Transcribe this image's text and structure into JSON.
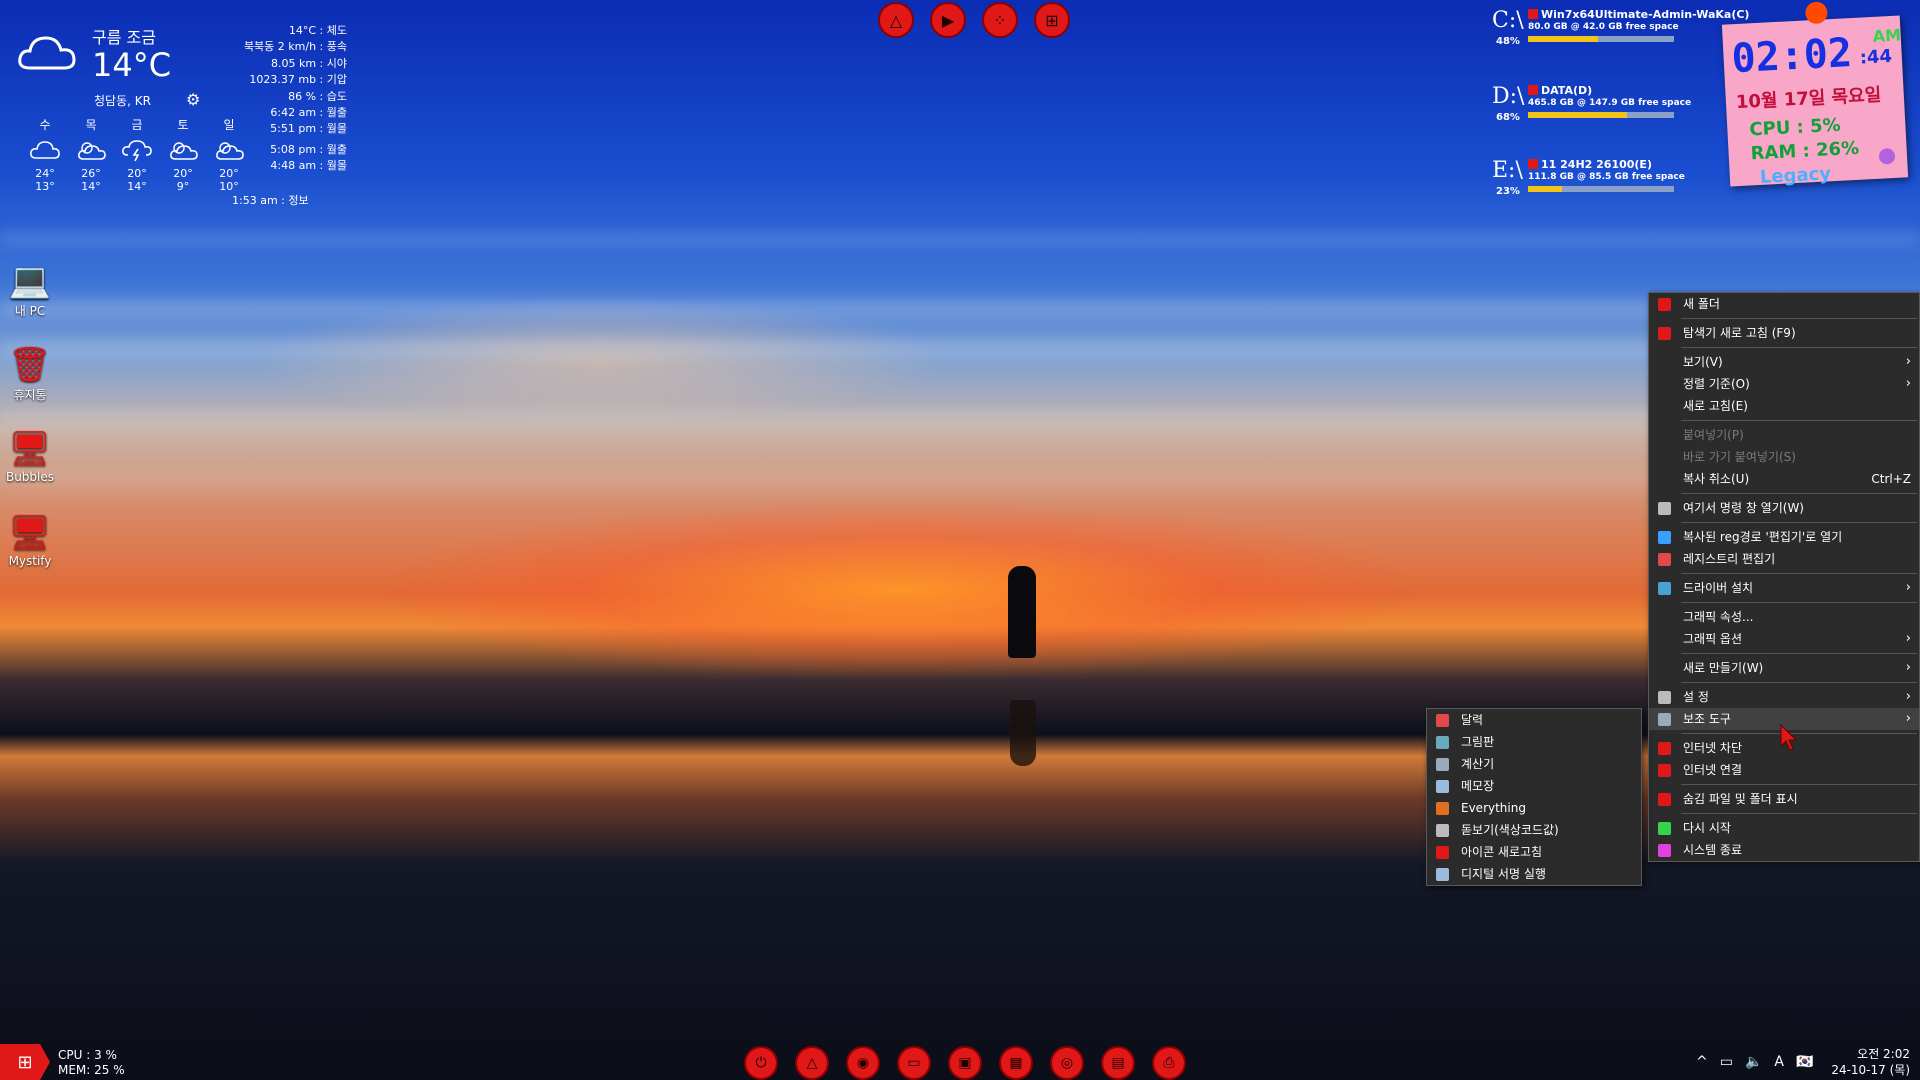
{
  "weather": {
    "condition": "구름 조금",
    "temp": "14°C",
    "location": "청담동, KR",
    "stats": [
      "14°C : 체도",
      "북북동 2 km/h : 풍속",
      "8.05 km : 시야",
      "1023.37 mb : 기압",
      "86 % : 습도",
      "6:42 am : 월출",
      "5:51 pm : 월몰",
      "5:08 pm : 월출",
      "4:48 am : 월몰"
    ],
    "updated": "1:53 am : 정보",
    "forecast": [
      {
        "day": "수",
        "hi": "24°",
        "lo": "13°",
        "icon": "cloud-icon"
      },
      {
        "day": "목",
        "hi": "26°",
        "lo": "14°",
        "icon": "partly-sunny-icon"
      },
      {
        "day": "금",
        "hi": "20°",
        "lo": "14°",
        "icon": "thunder-icon"
      },
      {
        "day": "토",
        "hi": "20°",
        "lo": "9°",
        "icon": "partly-sunny-icon"
      },
      {
        "day": "일",
        "hi": "20°",
        "lo": "10°",
        "icon": "partly-sunny-icon"
      }
    ]
  },
  "desktop_icons": [
    {
      "label": "내 PC",
      "icon": "computer-icon"
    },
    {
      "label": "휴지통",
      "icon": "trash-icon"
    },
    {
      "label": "Bubbles",
      "icon": "monitor-icon"
    },
    {
      "label": "Mystify",
      "icon": "monitor-icon"
    }
  ],
  "top_icons": [
    "triangle-icon",
    "play-icon",
    "dots-icon",
    "windows-icon"
  ],
  "drives": [
    {
      "letter": "C:\\",
      "pct": "48%",
      "name": "Win7x64Ultimate-Admin-WaKa(C)",
      "info": "80.0 GB @    42.0 GB free space",
      "fill": 0.48
    },
    {
      "letter": "D:\\",
      "pct": "68%",
      "name": "DATA(D)",
      "info": "465.8 GB @ 147.9 GB free space",
      "fill": 0.68
    },
    {
      "letter": "E:\\",
      "pct": "23%",
      "name": "11 24H2 26100(E)",
      "info": "111.8 GB @ 85.5 GB free space",
      "fill": 0.23
    }
  ],
  "note": {
    "time": "02:02",
    "seconds": ":44",
    "ampm": "AM",
    "date": "10월 17일 목요일",
    "cpu": "CPU :  5%",
    "ram": "RAM :  26%",
    "legacy": "Legacy"
  },
  "main_menu": {
    "items": [
      {
        "label": "새 폴더",
        "icon": "folder-icon",
        "color": "#e01818"
      },
      {
        "sep": true
      },
      {
        "label": "탐색기 새로 고침 (F9)",
        "icon": "refresh-icon",
        "color": "#e01818"
      },
      {
        "sep": true
      },
      {
        "label": "보기(V)",
        "arrow": true
      },
      {
        "label": "정렬 기준(O)",
        "arrow": true
      },
      {
        "label": "새로 고침(E)"
      },
      {
        "sep": true
      },
      {
        "label": "붙여넣기(P)",
        "disabled": true
      },
      {
        "label": "바로 가기 붙여넣기(S)",
        "disabled": true
      },
      {
        "label": "복사 취소(U)",
        "shortcut": "Ctrl+Z"
      },
      {
        "sep": true
      },
      {
        "label": "여기서 명령 창 열기(W)",
        "icon": "cmd-icon",
        "color": "#bbbbbb"
      },
      {
        "sep": true
      },
      {
        "label": "복사된 reg경로 '편집기'로 열기",
        "icon": "registry-icon",
        "color": "#3aa0ff"
      },
      {
        "label": "레지스트리 편집기",
        "icon": "registry-icon",
        "color": "#e04a4a"
      },
      {
        "sep": true
      },
      {
        "label": "드라이버 설치",
        "icon": "driver-icon",
        "color": "#4aa0d0",
        "arrow": true
      },
      {
        "sep": true
      },
      {
        "label": "그래픽 속성..."
      },
      {
        "label": "그래픽 옵션",
        "arrow": true
      },
      {
        "sep": true
      },
      {
        "label": "새로 만들기(W)",
        "arrow": true
      },
      {
        "sep": true
      },
      {
        "label": "설        정",
        "icon": "gear-icon",
        "color": "#bbbbbb",
        "arrow": true
      },
      {
        "label": "보조 도구",
        "icon": "tools-icon",
        "color": "#9ab",
        "arrow": true,
        "highlight": true
      },
      {
        "sep": true
      },
      {
        "label": "인터넷 차단",
        "icon": "net-block-icon",
        "color": "#e01818"
      },
      {
        "label": "인터넷 연결",
        "icon": "net-connect-icon",
        "color": "#e01818"
      },
      {
        "sep": true
      },
      {
        "label": "숨김 파일 및 폴더 표시",
        "icon": "check-icon",
        "color": "#e01818"
      },
      {
        "sep": true
      },
      {
        "label": "다시 시작",
        "icon": "power-icon",
        "color": "#36d44a"
      },
      {
        "label": "시스템 종료",
        "icon": "power-icon",
        "color": "#e040e0"
      }
    ]
  },
  "sub_menu": {
    "items": [
      {
        "label": "달력",
        "icon": "calendar-icon",
        "color": "#e04a4a"
      },
      {
        "label": "그림판",
        "icon": "paint-icon",
        "color": "#6ab"
      },
      {
        "label": "계산기",
        "icon": "calculator-icon",
        "color": "#9ab"
      },
      {
        "label": "메모장",
        "icon": "notepad-icon",
        "color": "#9bd"
      },
      {
        "label": "Everything",
        "icon": "search-icon",
        "color": "#e07020"
      },
      {
        "label": "돋보기(색상코드값)",
        "icon": "magnifier-icon",
        "color": "#bbb"
      },
      {
        "label": "아이콘 새로고침",
        "icon": "refresh-icon",
        "color": "#e01818"
      },
      {
        "label": "디지털 서명 실행",
        "icon": "signature-icon",
        "color": "#9bd"
      }
    ]
  },
  "taskbar": {
    "cpu": "CPU :   3 %",
    "mem": "MEM: 25 %",
    "dock": [
      "power-icon",
      "triangle-icon",
      "media-icon",
      "display-icon",
      "monitor-icon",
      "chip-icon",
      "chrome-icon",
      "clipboard-icon",
      "printer-icon"
    ],
    "tray_time": "오전 2:02",
    "tray_date": "24-10-17 (목)",
    "ime": "A"
  }
}
